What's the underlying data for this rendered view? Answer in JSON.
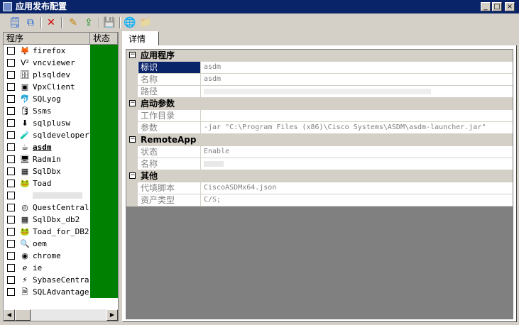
{
  "window": {
    "title": "应用发布配置",
    "minimize": "_",
    "maximize": "□",
    "close": "×"
  },
  "toolbar": {
    "buttons": [
      {
        "name": "new-icon",
        "glyph": "🗒"
      },
      {
        "name": "copy-icon",
        "glyph": "⧉"
      },
      {
        "name": "delete-icon",
        "glyph": "✕"
      },
      {
        "name": "edit-icon",
        "glyph": "✎"
      },
      {
        "name": "upload-icon",
        "glyph": "⇪"
      },
      {
        "name": "save-icon",
        "glyph": "💾"
      },
      {
        "name": "publish-icon",
        "glyph": "🌐"
      },
      {
        "name": "import-icon",
        "glyph": "📁"
      }
    ]
  },
  "app_list": {
    "columns": [
      "程序",
      "状态"
    ],
    "status_color": "#008000",
    "rows": [
      {
        "name": "firefox",
        "icon": "firefox-icon",
        "glyph": "🦊"
      },
      {
        "name": "vncviewer",
        "icon": "vnc-icon",
        "glyph": "V²"
      },
      {
        "name": "plsqldev",
        "icon": "plsqldev-icon",
        "glyph": "🗄"
      },
      {
        "name": "VpxClient",
        "icon": "vpxclient-icon",
        "glyph": "▣"
      },
      {
        "name": "SQLyog",
        "icon": "sqlyog-icon",
        "glyph": "🐬"
      },
      {
        "name": "Ssms",
        "icon": "ssms-icon",
        "glyph": "🛢"
      },
      {
        "name": "sqlplusw",
        "icon": "sqlplus-icon",
        "glyph": "⬇"
      },
      {
        "name": "sqldeveloperW",
        "icon": "sqldeveloper-icon",
        "glyph": "🧪"
      },
      {
        "name": "asdm",
        "icon": "asdm-icon",
        "glyph": "☕",
        "selected": true
      },
      {
        "name": "Radmin",
        "icon": "radmin-icon",
        "glyph": "🖥"
      },
      {
        "name": "SqlDbx",
        "icon": "sqldbx-icon",
        "glyph": "▦"
      },
      {
        "name": "Toad",
        "icon": "toad-icon",
        "glyph": "🐸"
      },
      {
        "name": "",
        "icon": "blurred-app-icon",
        "glyph": "",
        "blurred": true
      },
      {
        "name": "QuestCentral",
        "icon": "questcentral-icon",
        "glyph": "◎"
      },
      {
        "name": "SqlDbx_db2",
        "icon": "sqldbx-db2-icon",
        "glyph": "▦"
      },
      {
        "name": "Toad_for_DB2",
        "icon": "toad-db2-icon",
        "glyph": "🐸"
      },
      {
        "name": "oem",
        "icon": "oem-icon",
        "glyph": "🔍"
      },
      {
        "name": "chrome",
        "icon": "chrome-icon",
        "glyph": "◉"
      },
      {
        "name": "ie",
        "icon": "ie-icon",
        "glyph": "ℯ"
      },
      {
        "name": "SybaseCentral",
        "icon": "sybasecentral-icon",
        "glyph": "⚡"
      },
      {
        "name": "SQLAdvantage",
        "icon": "sqladvantage-icon",
        "glyph": "🗎"
      }
    ]
  },
  "tabs": [
    {
      "label": "详情"
    }
  ],
  "details": {
    "sections": [
      {
        "title": "应用程序",
        "props": [
          {
            "name": "标识",
            "value": "asdm",
            "highlight": true
          },
          {
            "name": "名称",
            "value": "asdm"
          },
          {
            "name": "路径",
            "value": "",
            "blurred": "long"
          }
        ]
      },
      {
        "title": "启动参数",
        "props": [
          {
            "name": "工作目录",
            "value": ""
          },
          {
            "name": "参数",
            "value": "-jar \"C:\\Program Files (x86)\\Cisco Systems\\ASDM\\asdm-launcher.jar\""
          }
        ]
      },
      {
        "title": "RemoteApp",
        "props": [
          {
            "name": "状态",
            "value": "Enable"
          },
          {
            "name": "名称",
            "value": "",
            "blurred": "short"
          }
        ]
      },
      {
        "title": "其他",
        "props": [
          {
            "name": "代填脚本",
            "value": "CiscoASDMx64.json"
          },
          {
            "name": "资产类型",
            "value": "C/S;"
          }
        ]
      }
    ]
  }
}
